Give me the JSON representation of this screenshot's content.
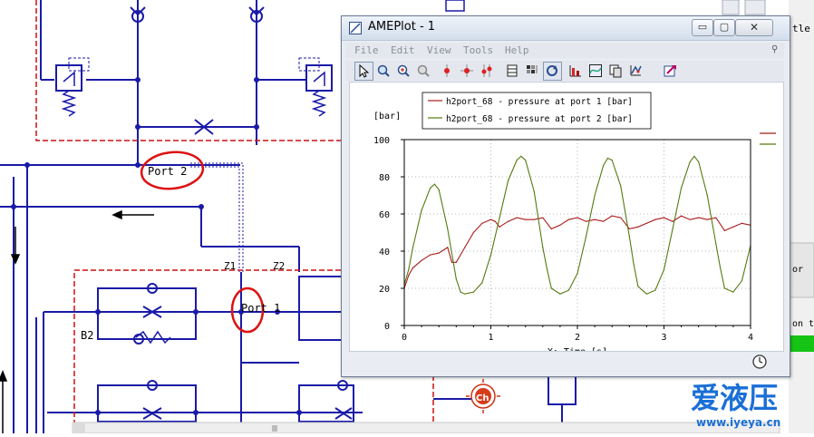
{
  "schematic": {
    "port2_label": "Port 2",
    "port1_label": "Port 1",
    "z1_label": "Z1",
    "z2_label": "Z2",
    "b2_label": "B2",
    "ch_label": "Ch",
    "right_fragment_1": "tle",
    "right_fragment_2": "or",
    "right_fragment_3": "on t",
    "colors": {
      "line": "#1a1aa8",
      "dashed_frame": "#cc1111",
      "annotation": "#dd1111"
    }
  },
  "window": {
    "title": "AMEPlot - 1",
    "buttons": {
      "minimize": "▭",
      "maximize": "▢",
      "close": "✕"
    },
    "menu": [
      "File",
      "Edit",
      "View",
      "Tools",
      "Help"
    ],
    "toolbar_icons": [
      "pointer-icon",
      "zoom-icon",
      "zoom-fit-icon",
      "pan-icon",
      "marker-icon",
      "crosshair-icon",
      "multi-marker-icon",
      "table-icon",
      "grid-icon",
      "refresh-icon",
      "bar-chart-icon",
      "curve-icon",
      "copy-icon",
      "plot-3d-icon",
      "export-icon"
    ],
    "status_icon": "clock-icon"
  },
  "chart_data": {
    "type": "line",
    "ylabel": "[bar]",
    "xlabel": "X: Time [s]",
    "xlim": [
      0,
      4
    ],
    "ylim": [
      0,
      100
    ],
    "x_ticks": [
      "0",
      "1",
      "2",
      "3",
      "4"
    ],
    "y_ticks": [
      "0",
      "20",
      "40",
      "60",
      "80",
      "100"
    ],
    "grid": true,
    "legend_position": "top-center",
    "series": [
      {
        "name": "h2port_68 - pressure at port 1 [bar]",
        "color": "#aa1a1a",
        "x": [
          0,
          0.05,
          0.1,
          0.2,
          0.3,
          0.4,
          0.5,
          0.55,
          0.6,
          0.7,
          0.8,
          0.9,
          1.0,
          1.05,
          1.1,
          1.2,
          1.3,
          1.4,
          1.5,
          1.6,
          1.7,
          1.8,
          1.9,
          2.0,
          2.1,
          2.2,
          2.3,
          2.4,
          2.5,
          2.6,
          2.7,
          2.8,
          2.9,
          3.0,
          3.1,
          3.2,
          3.3,
          3.4,
          3.5,
          3.6,
          3.7,
          3.8,
          3.9,
          4.0
        ],
        "y": [
          20,
          27,
          31,
          35,
          38,
          39,
          42,
          34,
          34,
          42,
          50,
          55,
          57,
          56,
          53,
          56,
          58,
          57,
          57,
          58,
          52,
          54,
          57,
          58,
          56,
          57,
          56,
          59,
          58,
          52,
          53,
          55,
          57,
          58,
          56,
          59,
          57,
          58,
          57,
          58,
          51,
          53,
          55,
          54
        ]
      },
      {
        "name": "h2port_68 - pressure at port 2 [bar]",
        "color": "#557a10",
        "x": [
          0,
          0.05,
          0.1,
          0.2,
          0.3,
          0.35,
          0.4,
          0.5,
          0.6,
          0.65,
          0.7,
          0.8,
          0.9,
          1.0,
          1.1,
          1.2,
          1.3,
          1.35,
          1.4,
          1.5,
          1.6,
          1.65,
          1.7,
          1.8,
          1.9,
          2.0,
          2.1,
          2.2,
          2.3,
          2.35,
          2.4,
          2.5,
          2.6,
          2.65,
          2.7,
          2.8,
          2.9,
          3.0,
          3.1,
          3.2,
          3.3,
          3.35,
          3.4,
          3.5,
          3.6,
          3.65,
          3.7,
          3.8,
          3.9,
          4.0
        ],
        "y": [
          22,
          30,
          42,
          62,
          74,
          76,
          73,
          52,
          25,
          18,
          17,
          18,
          23,
          38,
          58,
          78,
          89,
          91,
          89,
          72,
          42,
          30,
          20,
          17,
          19,
          28,
          48,
          70,
          86,
          90,
          89,
          75,
          48,
          33,
          21,
          17,
          19,
          30,
          52,
          74,
          88,
          91,
          88,
          70,
          44,
          31,
          20,
          18,
          24,
          43
        ]
      }
    ],
    "outside_legend_colors": [
      "#aa1a1a",
      "#557a10"
    ]
  },
  "watermark": {
    "cn_text": "爱液压",
    "url": "www.iyeya.cn",
    "color": "#1a6fd6"
  }
}
